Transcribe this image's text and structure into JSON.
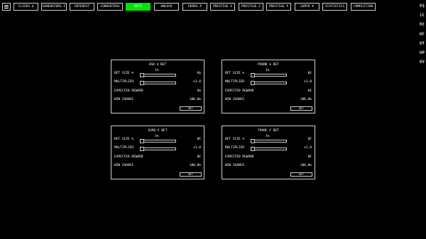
{
  "tabs": [
    {
      "label": "CLICKS $",
      "active": false
    },
    {
      "label": "GENERATORS €",
      "active": false
    },
    {
      "label": "INTEREST",
      "active": false
    },
    {
      "label": "CONVERTERS",
      "active": false
    },
    {
      "label": "BETS",
      "active": true
    },
    {
      "label": "UNLOCK",
      "active": false
    },
    {
      "label": "PERKS ₽",
      "active": false
    },
    {
      "label": "PRESTIGE £",
      "active": false
    },
    {
      "label": "PRESTIGE ₣",
      "active": false
    },
    {
      "label": "PRESTIGE ₹",
      "active": false
    },
    {
      "label": "SUPER ¥",
      "active": false
    },
    {
      "label": "STATISTICS",
      "active": false
    },
    {
      "label": "COMPLETION",
      "active": false
    }
  ],
  "balances": [
    "0$",
    "1€",
    "0£",
    "0₣",
    "0₹",
    "0₽",
    "0¥"
  ],
  "labels": {
    "bet_size": "BET SIZE %",
    "multiplier": "MULTIPLIER",
    "expected_reward": "EXPECTED REWARD",
    "win_chance": "WIN CHANCE",
    "bet_button": "BET"
  },
  "panels": [
    {
      "title": "USD $ BET",
      "pct": "1%",
      "bet_size_value": "0$",
      "multiplier_value": "x1,0",
      "expected_value": "0$",
      "win_chance_value": "100,0%"
    },
    {
      "title": "POUND £ BET",
      "pct": "1%",
      "bet_size_value": "0£",
      "multiplier_value": "x1,0",
      "expected_value": "0£",
      "win_chance_value": "100,0%"
    },
    {
      "title": "EURO € BET",
      "pct": "1%",
      "bet_size_value": "0€",
      "multiplier_value": "x1,0",
      "expected_value": "0€",
      "win_chance_value": "100,0%"
    },
    {
      "title": "FRANC ₣ BET",
      "pct": "1%",
      "bet_size_value": "0₣",
      "multiplier_value": "x1,0",
      "expected_value": "0₣",
      "win_chance_value": "100,0%"
    }
  ]
}
